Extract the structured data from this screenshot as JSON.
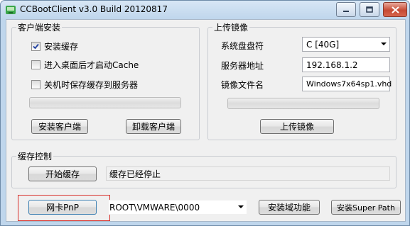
{
  "window": {
    "title": "CCBootClient v3.0 Build 20120817",
    "controls": [
      "minimize-icon",
      "maximize-icon",
      "close-icon"
    ]
  },
  "client_install": {
    "group_title": "客户端安装",
    "checkboxes": [
      {
        "label": "安装缓存",
        "checked": true
      },
      {
        "label": "进入桌面后才启动Cache",
        "checked": false
      },
      {
        "label": "关机时保存缓存到服务器",
        "checked": false
      }
    ],
    "progress": 0,
    "install_button": "安装客户端",
    "uninstall_button": "卸载客户端"
  },
  "upload_image": {
    "group_title": "上传镜像",
    "system_disk_label": "系统盘盘符",
    "system_disk_value": "C [40G]",
    "server_addr_label": "服务器地址",
    "server_addr_value": "192.168.1.2",
    "image_file_label": "镜像文件名",
    "image_file_value": "Windows7x64sp1.vhd",
    "progress": 0,
    "upload_button": "上传镜像"
  },
  "cache_control": {
    "group_title": "缓存控制",
    "start_button": "开始缓存",
    "status_text": "缓存已经停止"
  },
  "bottom": {
    "nic_pnp_button": "网卡PnP",
    "device_combo_value": "ROOT\\VMWARE\\0000",
    "install_domain_button": "安装域功能",
    "install_super_path_button": "安装Super Path"
  },
  "colors": {
    "highlight_border": "#d8322d",
    "title_bar": "#bfd6ec",
    "checkmark": "#1f3fa0"
  }
}
